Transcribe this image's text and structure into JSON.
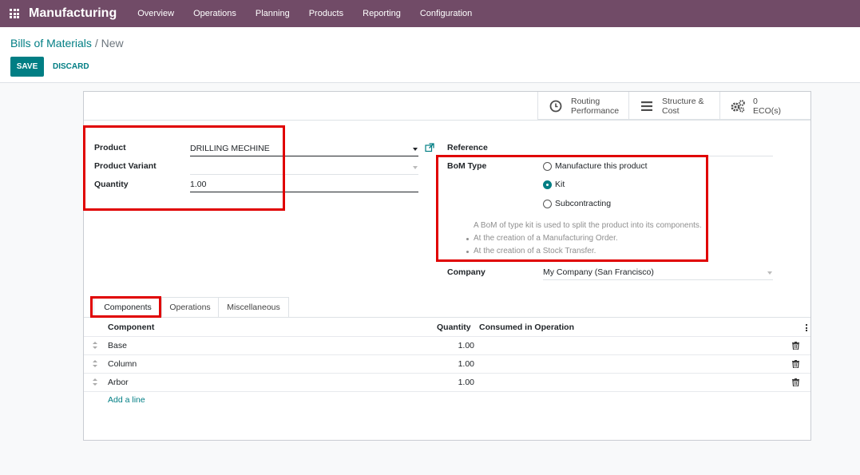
{
  "app": {
    "name": "Manufacturing"
  },
  "menu": [
    "Overview",
    "Operations",
    "Planning",
    "Products",
    "Reporting",
    "Configuration"
  ],
  "breadcrumb": {
    "parent": "Bills of Materials",
    "separator": "/",
    "current": "New"
  },
  "actions": {
    "save": "SAVE",
    "discard": "DISCARD"
  },
  "smart_buttons": [
    {
      "line1": "Routing",
      "line2": "Performance",
      "icon": "clock-icon"
    },
    {
      "line1": "Structure &",
      "line2": "Cost",
      "icon": "bars-icon"
    },
    {
      "line1": "0",
      "line2": "ECO(s)",
      "icon": "gears-icon"
    }
  ],
  "form": {
    "product_label": "Product",
    "product_value": "DRILLING MECHINE",
    "variant_label": "Product Variant",
    "variant_value": "",
    "quantity_label": "Quantity",
    "quantity_value": "1.00",
    "reference_label": "Reference",
    "reference_value": "",
    "bom_type_label": "BoM Type",
    "bom_type_options": [
      "Manufacture this product",
      "Kit",
      "Subcontracting"
    ],
    "bom_type_selected": "Kit",
    "help_lines": [
      "A BoM of type kit is used to split the product into its components.",
      "At the creation of a Manufacturing Order.",
      "At the creation of a Stock Transfer."
    ],
    "company_label": "Company",
    "company_value": "My Company (San Francisco)"
  },
  "tabs": [
    "Components",
    "Operations",
    "Miscellaneous"
  ],
  "active_tab": "Components",
  "table": {
    "headers": {
      "component": "Component",
      "quantity": "Quantity",
      "consumed": "Consumed in Operation"
    },
    "rows": [
      {
        "component": "Base",
        "quantity": "1.00"
      },
      {
        "component": "Column",
        "quantity": "1.00"
      },
      {
        "component": "Arbor",
        "quantity": "1.00"
      }
    ],
    "add_line": "Add a line"
  },
  "colors": {
    "navbar": "#714B67",
    "primary": "#017e84",
    "highlight": "#e00000"
  }
}
